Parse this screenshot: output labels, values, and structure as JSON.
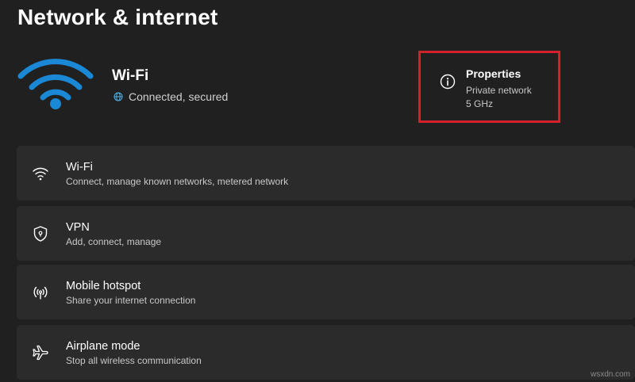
{
  "page": {
    "title": "Network & internet"
  },
  "hero": {
    "network_name": "Wi-Fi",
    "status": "Connected, secured",
    "icon": "wifi-large-icon",
    "accent_color": "#1b88d6"
  },
  "properties": {
    "title": "Properties",
    "network_type": "Private network",
    "band": "5 GHz",
    "icon": "info-icon",
    "highlight_color": "#d4202a"
  },
  "settings": {
    "items": [
      {
        "title": "Wi-Fi",
        "subtitle": "Connect, manage known networks, metered network",
        "icon": "wifi-icon"
      },
      {
        "title": "VPN",
        "subtitle": "Add, connect, manage",
        "icon": "shield-icon"
      },
      {
        "title": "Mobile hotspot",
        "subtitle": "Share your internet connection",
        "icon": "hotspot-icon"
      },
      {
        "title": "Airplane mode",
        "subtitle": "Stop all wireless communication",
        "icon": "airplane-icon"
      }
    ]
  },
  "watermark": "wsxdn.com"
}
